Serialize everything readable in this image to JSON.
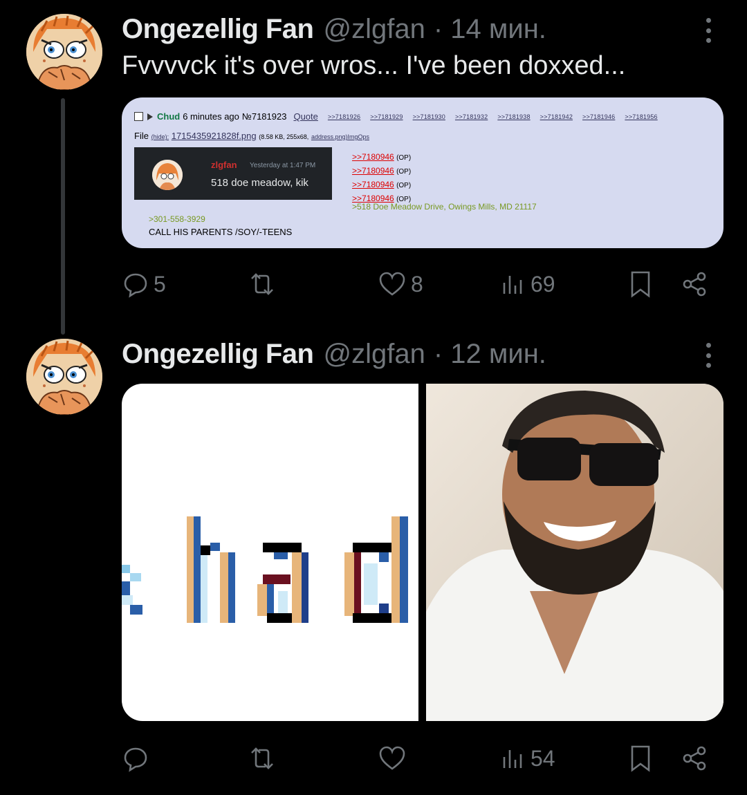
{
  "tweets": [
    {
      "author_name": "Ongezellig Fan",
      "handle": "@zlgfan",
      "time": "· 14 мин.",
      "text": "Fvvvvck it's over wros... I've been doxxed...",
      "replies": "5",
      "reposts": "",
      "likes": "8",
      "views": "69"
    },
    {
      "author_name": "Ongezellig Fan",
      "handle": "@zlgfan",
      "time": "· 12 мин.",
      "replies": "",
      "reposts": "",
      "likes": "",
      "views": "54"
    }
  ],
  "chan_post": {
    "poster": "Chud",
    "time_ago": "6 minutes ago",
    "post_no": "№7181923",
    "quote_label": "Quote",
    "backlinks": [
      ">>7181926",
      ">>7181929",
      ">>7181930",
      ">>7181932",
      ">>7181938",
      ">>7181942",
      ">>7181946",
      ">>7181956"
    ],
    "file_label": "File",
    "hide_label": "(hide):",
    "file_name": "1715435921828f.png",
    "file_meta": "(8.58 KB, 255x68,",
    "file_links": "address.png)ImgOps",
    "thumb_name": "zlgfan",
    "thumb_time": "Yesterday at 1:47 PM",
    "thumb_message": "518 doe meadow, kik",
    "quote_refs": [
      ">>7180946",
      ">>7180946",
      ">>7180946",
      ">>7180946"
    ],
    "op_label": "(OP)",
    "address_line": ">518 Doe Meadow Drive, Owings Mills, MD 21117",
    "phone_line": ">301-558-3929",
    "call_line": "CALL HIS PARENTS /SOY/-TEENS"
  },
  "media_left_text": "had",
  "icons": [
    "reply-icon",
    "repost-icon",
    "like-icon",
    "views-icon",
    "bookmark-icon",
    "share-icon",
    "more-icon"
  ],
  "colors": {
    "background": "#000000",
    "muted": "#71767b",
    "text": "#e7e9ea",
    "chan_bg": "#d6daf0",
    "chan_green": "#117743",
    "greentext": "#789922",
    "chan_link_red": "#dd0000"
  }
}
